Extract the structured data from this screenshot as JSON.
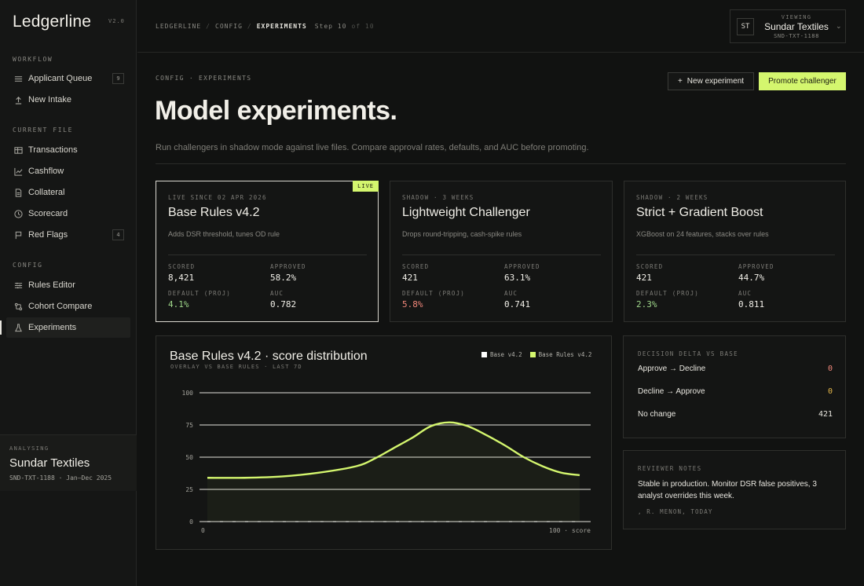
{
  "app": {
    "name": "Ledgerline",
    "version": "V2.0"
  },
  "sidebar": {
    "sections": [
      {
        "title": "WORKFLOW",
        "items": [
          {
            "label": "Applicant Queue",
            "icon": "list-icon",
            "badge": "9"
          },
          {
            "label": "New Intake",
            "icon": "upload-icon"
          }
        ]
      },
      {
        "title": "CURRENT FILE",
        "items": [
          {
            "label": "Transactions",
            "icon": "table-icon"
          },
          {
            "label": "Cashflow",
            "icon": "trend-chart-icon"
          },
          {
            "label": "Collateral",
            "icon": "document-icon"
          },
          {
            "label": "Scorecard",
            "icon": "gauge-icon"
          },
          {
            "label": "Red Flags",
            "icon": "flag-icon",
            "badge": "4"
          }
        ]
      },
      {
        "title": "CONFIG",
        "items": [
          {
            "label": "Rules Editor",
            "icon": "sliders-icon"
          },
          {
            "label": "Cohort Compare",
            "icon": "compare-icon"
          },
          {
            "label": "Experiments",
            "icon": "flask-icon",
            "active": true
          }
        ]
      }
    ],
    "analysing": {
      "label": "ANALYSING",
      "name": "Sundar Textiles",
      "sub": "SND-TXT-1188 · Jan–Dec 2025"
    }
  },
  "topbar": {
    "crumbs": [
      "LEDGERLINE",
      "CONFIG",
      "EXPERIMENTS"
    ],
    "step": "Step 10",
    "step_of": "of 10",
    "viewing": {
      "label": "VIEWING",
      "initials": "ST",
      "name": "Sundar Textiles",
      "id": "SND-TXT-1188"
    }
  },
  "header": {
    "eyebrow": "CONFIG · EXPERIMENTS",
    "title": "Model experiments.",
    "description": "Run challengers in shadow mode against live files. Compare approval rates, defaults, and AUC before promoting.",
    "new_button": "New experiment",
    "promote_button": "Promote challenger"
  },
  "cards": [
    {
      "since": "LIVE SINCE 02 APR 2026",
      "name": "Base Rules v4.2",
      "desc": "Adds DSR threshold, tunes OD rule",
      "live": true,
      "live_tag": "LIVE",
      "scored": "8,421",
      "approved": "58.2%",
      "default": "4.1%",
      "default_tone": "good",
      "auc": "0.782"
    },
    {
      "since": "SHADOW · 3 WEEKS",
      "name": "Lightweight Challenger",
      "desc": "Drops round-tripping, cash-spike rules",
      "live": false,
      "scored": "421",
      "approved": "63.1%",
      "default": "5.8%",
      "default_tone": "bad",
      "auc": "0.741"
    },
    {
      "since": "SHADOW · 2 WEEKS",
      "name": "Strict + Gradient Boost",
      "desc": "XGBoost on 24 features, stacks over rules",
      "live": false,
      "scored": "421",
      "approved": "44.7%",
      "default": "2.3%",
      "default_tone": "good",
      "auc": "0.811"
    }
  ],
  "stat_labels": {
    "scored": "SCORED",
    "approved": "APPROVED",
    "default": "DEFAULT (PROJ)",
    "auc": "AUC"
  },
  "chart_data": {
    "type": "line",
    "title": "Base Rules v4.2 · score distribution",
    "subtitle": "OVERLAY VS BASE RULES · LAST 7D",
    "x_start_label": "0",
    "x_end_label": "100 · score",
    "ylim": [
      0,
      100
    ],
    "yticks": [
      0,
      25,
      50,
      75,
      100
    ],
    "grid": true,
    "legend_position": "top-right",
    "colors": {
      "base": "#ffffff",
      "challenger": "#d4f66e"
    },
    "x": [
      0,
      10,
      20,
      30,
      40,
      45,
      50,
      55,
      60,
      65,
      70,
      75,
      80,
      85,
      90,
      95,
      100
    ],
    "series": [
      {
        "name": "Base v4.2",
        "color": "#ffffff",
        "values": [
          0,
          0,
          0,
          0,
          0,
          0,
          0,
          0,
          0,
          0,
          0,
          0,
          0,
          0,
          0,
          0,
          0
        ]
      },
      {
        "name": "Base Rules v4.2",
        "color": "#d4f66e",
        "values": [
          34,
          34,
          35,
          38,
          43,
          49,
          57,
          65,
          74,
          77,
          74,
          67,
          59,
          50,
          43,
          38,
          36
        ]
      }
    ]
  },
  "delta_panel": {
    "title": "DECISION DELTA VS BASE",
    "rows": [
      {
        "label": "Approve → Decline",
        "value": "0",
        "tone": "warn"
      },
      {
        "label": "Decline → Approve",
        "value": "0",
        "tone": "amber"
      },
      {
        "label": "No change",
        "value": "421",
        "tone": ""
      }
    ]
  },
  "notes_panel": {
    "title": "REVIEWER NOTES",
    "text": "Stable in production. Monitor DSR false positives, 3 analyst overrides this week.",
    "signature": ", R. MENON, TODAY"
  }
}
